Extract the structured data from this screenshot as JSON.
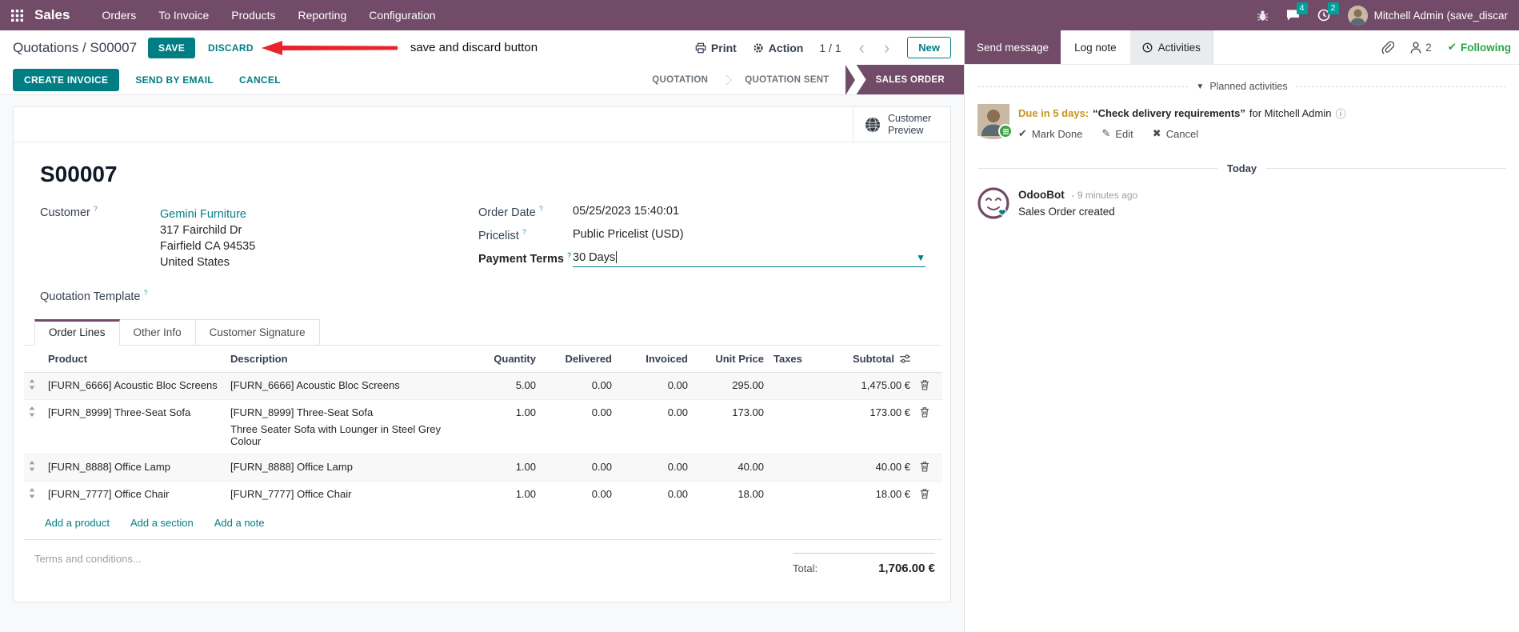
{
  "navbar": {
    "app": "Sales",
    "menus": [
      "Orders",
      "To Invoice",
      "Products",
      "Reporting",
      "Configuration"
    ],
    "messages_badge": "4",
    "activities_badge": "2",
    "user": "Mitchell Admin (save_discar"
  },
  "breadcrumb": {
    "parent": "Quotations",
    "separator": " / ",
    "current": "S00007"
  },
  "edit_bar": {
    "save": "SAVE",
    "discard": "DISCARD"
  },
  "annotation": {
    "label": "save and discard button"
  },
  "control_panel": {
    "print": "Print",
    "action": "Action",
    "pager": "1 / 1",
    "new": "New"
  },
  "action_buttons": {
    "create_invoice": "CREATE INVOICE",
    "send_by_email": "SEND BY EMAIL",
    "cancel": "CANCEL"
  },
  "stages": {
    "quotation": "QUOTATION",
    "quotation_sent": "QUOTATION SENT",
    "sales_order": "SALES ORDER"
  },
  "form": {
    "customer_preview": "Customer Preview",
    "reference": "S00007",
    "customer": {
      "label": "Customer",
      "help": "?",
      "name": "Gemini Furniture",
      "street": "317 Fairchild Dr",
      "city": "Fairfield CA 94535",
      "country": "United States"
    },
    "order_date": {
      "label": "Order Date",
      "help": "?",
      "value": "05/25/2023 15:40:01"
    },
    "pricelist": {
      "label": "Pricelist",
      "help": "?",
      "value": "Public Pricelist (USD)"
    },
    "payment_terms": {
      "label": "Payment Terms",
      "help": "?",
      "value": "30 Days"
    },
    "quotation_template": {
      "label": "Quotation Template",
      "help": "?"
    },
    "tabs": [
      {
        "label": "Order Lines"
      },
      {
        "label": "Other Info"
      },
      {
        "label": "Customer Signature"
      }
    ],
    "table": {
      "headers": {
        "product": "Product",
        "description": "Description",
        "quantity": "Quantity",
        "delivered": "Delivered",
        "invoiced": "Invoiced",
        "unit_price": "Unit Price",
        "taxes": "Taxes",
        "subtotal": "Subtotal"
      },
      "rows": [
        {
          "product": "[FURN_6666] Acoustic Bloc Screens",
          "description": "[FURN_6666] Acoustic Bloc Screens",
          "description2": "",
          "quantity": "5.00",
          "delivered": "0.00",
          "invoiced": "0.00",
          "unit_price": "295.00",
          "taxes": "",
          "subtotal": "1,475.00 €"
        },
        {
          "product": "[FURN_8999] Three-Seat Sofa",
          "description": "[FURN_8999] Three-Seat Sofa",
          "description2": "Three Seater Sofa with Lounger in Steel Grey Colour",
          "quantity": "1.00",
          "delivered": "0.00",
          "invoiced": "0.00",
          "unit_price": "173.00",
          "taxes": "",
          "subtotal": "173.00 €"
        },
        {
          "product": "[FURN_8888] Office Lamp",
          "description": "[FURN_8888] Office Lamp",
          "description2": "",
          "quantity": "1.00",
          "delivered": "0.00",
          "invoiced": "0.00",
          "unit_price": "40.00",
          "taxes": "",
          "subtotal": "40.00 €"
        },
        {
          "product": "[FURN_7777] Office Chair",
          "description": "[FURN_7777] Office Chair",
          "description2": "",
          "quantity": "1.00",
          "delivered": "0.00",
          "invoiced": "0.00",
          "unit_price": "18.00",
          "taxes": "",
          "subtotal": "18.00 €"
        }
      ],
      "links": {
        "add_product": "Add a product",
        "add_section": "Add a section",
        "add_note": "Add a note"
      }
    },
    "terms_placeholder": "Terms and conditions...",
    "total": {
      "label": "Total:",
      "value": "1,706.00 €"
    }
  },
  "chatter": {
    "send_message": "Send message",
    "log_note": "Log note",
    "activities": "Activities",
    "followers_count": "2",
    "following": "Following",
    "planned": {
      "header": "Planned activities",
      "due": "Due in 5 days:",
      "summary": "“Check delivery requirements”",
      "assignee": "for Mitchell Admin",
      "mark_done": "Mark Done",
      "edit": "Edit",
      "cancel": "Cancel"
    },
    "today": "Today",
    "message": {
      "author": "OdooBot",
      "time": "- 9 minutes ago",
      "body": "Sales Order created"
    }
  },
  "colors": {
    "brand": "#714B67",
    "accent": "#017E84",
    "badge": "#00A09D",
    "following_green": "#28a745",
    "due_amber": "#C7941C",
    "annotation_red": "#E8232A"
  }
}
